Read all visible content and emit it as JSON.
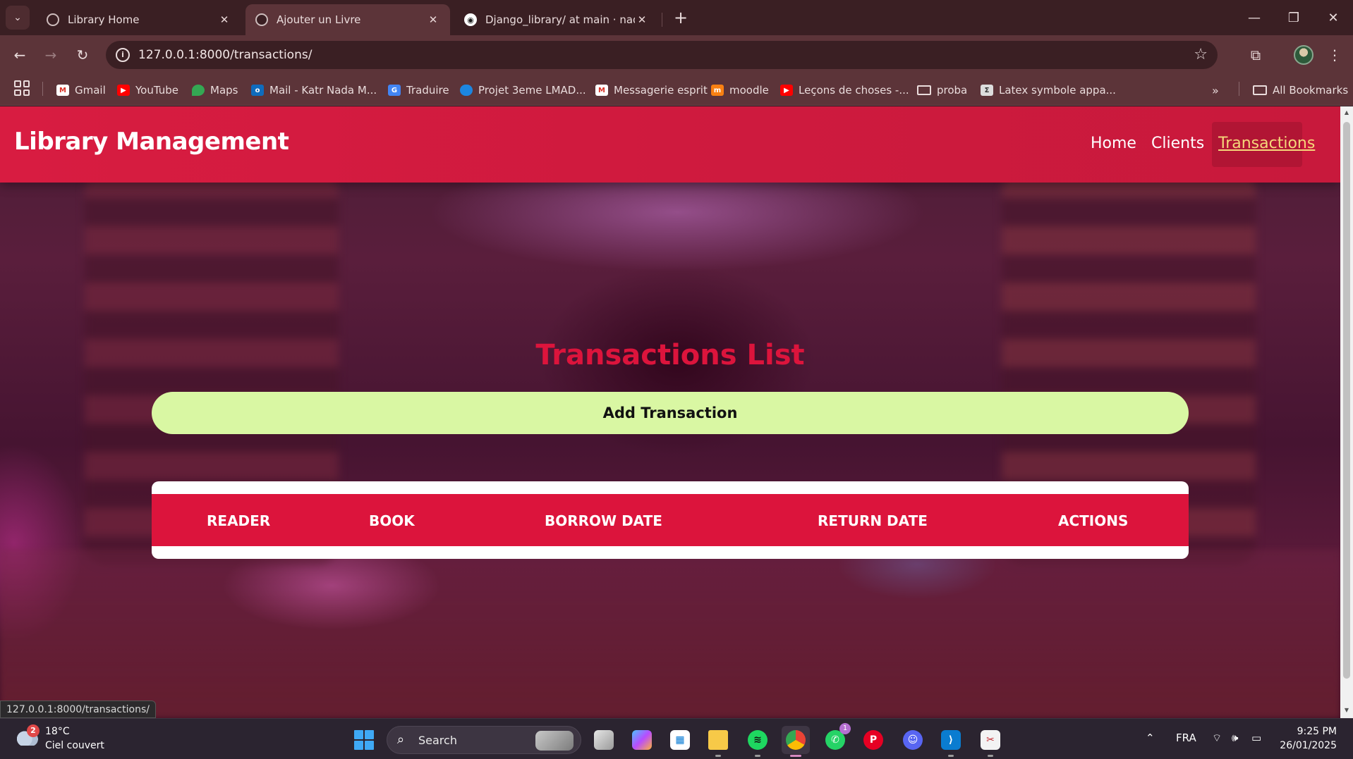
{
  "browser": {
    "tabs": [
      {
        "title": "Library Home"
      },
      {
        "title": "Ajouter un Livre"
      },
      {
        "title": "Django_library/ at main · nadan"
      }
    ],
    "new_tab_symbol": "+",
    "address": "127.0.0.1:8000/transactions/",
    "bookmarks": [
      {
        "label": "Gmail",
        "icon": "gmail-icon"
      },
      {
        "label": "YouTube",
        "icon": "youtube-icon"
      },
      {
        "label": "Maps",
        "icon": "maps-icon"
      },
      {
        "label": "Mail - Katr Nada M...",
        "icon": "outlook-icon"
      },
      {
        "label": "Traduire",
        "icon": "translate-icon"
      },
      {
        "label": "Projet 3eme LMAD...",
        "icon": "onedrive-icon"
      },
      {
        "label": "Messagerie esprit",
        "icon": "gmail-icon"
      },
      {
        "label": "moodle",
        "icon": "moodle-icon"
      },
      {
        "label": "Leçons de choses -...",
        "icon": "youtube-icon"
      },
      {
        "label": "proba",
        "icon": "folder-icon"
      },
      {
        "label": "Latex symbole appa...",
        "icon": "latex-icon"
      }
    ],
    "all_bookmarks": "All Bookmarks",
    "status_url": "127.0.0.1:8000/transactions/"
  },
  "site": {
    "title": "Library Management",
    "nav": [
      "Home",
      "Clients",
      "Transactions"
    ],
    "active_nav": "Transactions"
  },
  "page": {
    "heading": "Transactions List",
    "add_button": "Add Transaction",
    "table_headers": [
      "READER",
      "BOOK",
      "BORROW DATE",
      "RETURN DATE",
      "ACTIONS"
    ]
  },
  "taskbar": {
    "weather_temp": "18°C",
    "weather_desc": "Ciel couvert",
    "weather_badge": "2",
    "search_label": "Search",
    "language": "FRA",
    "time": "9:25 PM",
    "date": "26/01/2025",
    "whatsapp_badge": "1"
  },
  "colors": {
    "header_red": "#dc143c",
    "add_button_bg": "#d9f7a3",
    "active_nav_text": "#f5d77a"
  }
}
